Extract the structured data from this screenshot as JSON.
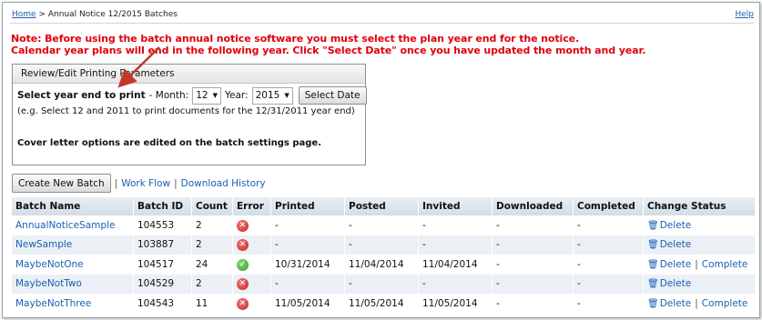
{
  "breadcrumb": {
    "home": "Home",
    "separator": ">",
    "current": "Annual Notice 12/2015 Batches"
  },
  "help_link": "Help",
  "note": {
    "line1": "Note: Before using the batch annual notice software you must select the plan year end for the notice.",
    "line2": "Calendar year plans will end in the following year. Click \"Select Date\" once you have updated the month and year."
  },
  "params_panel": {
    "title": "Review/Edit Printing Parameters",
    "prompt": "Select year end to print",
    "month_label": "- Month:",
    "month_value": "12",
    "year_label": "Year:",
    "year_value": "2015",
    "select_button": "Select Date",
    "example": "(e.g. Select 12 and 2011 to print documents for the 12/31/2011 year end)",
    "cover_note": "Cover letter options are edited on the batch settings page."
  },
  "actions": {
    "create_button": "Create New Batch",
    "separator": "|",
    "work_flow": "Work Flow",
    "download_history": "Download History"
  },
  "table": {
    "headers": [
      "Batch Name",
      "Batch ID",
      "Count",
      "Error",
      "Printed",
      "Posted",
      "Invited",
      "Downloaded",
      "Completed",
      "Change Status"
    ],
    "rows": [
      {
        "name": "AnnualNoticeSample",
        "id": "104553",
        "count": "2",
        "error": "fail",
        "printed": "-",
        "posted": "-",
        "invited": "-",
        "downloaded": "-",
        "completed": "-",
        "delete": "Delete",
        "complete": ""
      },
      {
        "name": "NewSample",
        "id": "103887",
        "count": "2",
        "error": "fail",
        "printed": "-",
        "posted": "-",
        "invited": "-",
        "downloaded": "-",
        "completed": "-",
        "delete": "Delete",
        "complete": ""
      },
      {
        "name": "MaybeNotOne",
        "id": "104517",
        "count": "24",
        "error": "ok",
        "printed": "10/31/2014",
        "posted": "11/04/2014",
        "invited": "11/04/2014",
        "downloaded": "-",
        "completed": "-",
        "delete": "Delete",
        "complete": "Complete"
      },
      {
        "name": "MaybeNotTwo",
        "id": "104529",
        "count": "2",
        "error": "fail",
        "printed": "-",
        "posted": "-",
        "invited": "-",
        "downloaded": "-",
        "completed": "-",
        "delete": "Delete",
        "complete": ""
      },
      {
        "name": "MaybeNotThree",
        "id": "104543",
        "count": "11",
        "error": "fail",
        "printed": "11/05/2014",
        "posted": "11/05/2014",
        "invited": "11/05/2014",
        "downloaded": "-",
        "completed": "-",
        "delete": "Delete",
        "complete": "Complete"
      }
    ]
  },
  "icons": {
    "error_fail": "error-x-icon",
    "error_ok": "check-icon",
    "delete": "trash-icon",
    "dropdown": "chevron-down-icon"
  },
  "colors": {
    "note_red": "#e0000c",
    "link_blue": "#1a5fb4",
    "annotation_arrow": "#c0392b"
  }
}
